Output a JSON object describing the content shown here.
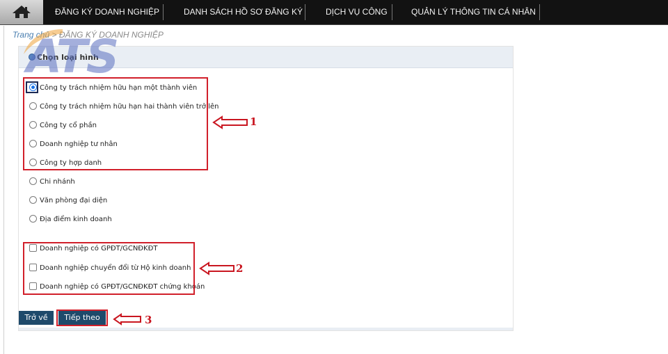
{
  "nav": {
    "items": [
      {
        "label": "ĐĂNG KÝ DOANH NGHIỆP"
      },
      {
        "label": "DANH SÁCH HỒ SƠ ĐĂNG KÝ"
      },
      {
        "label": "DỊCH VỤ CÔNG"
      },
      {
        "label": "QUẢN LÝ THÔNG TIN CÁ NHÂN"
      }
    ]
  },
  "breadcrumb": {
    "home": "Trang chủ",
    "separator": " > ",
    "current": "ĐĂNG KÝ DOANH NGHIỆP"
  },
  "watermark": "ATS",
  "panel": {
    "title": "Chọn loại hình"
  },
  "radio_options": [
    {
      "label": "Công ty trách nhiệm hữu hạn một thành viên",
      "checked": true
    },
    {
      "label": "Công ty trách nhiệm hữu hạn hai thành viên trở lên",
      "checked": false
    },
    {
      "label": "Công ty cổ phần",
      "checked": false
    },
    {
      "label": "Doanh nghiệp tư nhân",
      "checked": false
    },
    {
      "label": "Công ty hợp danh",
      "checked": false
    },
    {
      "label": "Chi nhánh",
      "checked": false
    },
    {
      "label": "Văn phòng đại diện",
      "checked": false
    },
    {
      "label": "Địa điểm kinh doanh",
      "checked": false
    }
  ],
  "checkbox_options": [
    {
      "label": "Doanh nghiệp có GPĐT/GCNĐKĐT",
      "checked": false
    },
    {
      "label": "Doanh nghiệp chuyển đổi từ Hộ kinh doanh",
      "checked": false
    },
    {
      "label": "Doanh nghiệp có GPĐT/GCNĐKĐT chứng khoán",
      "checked": false
    }
  ],
  "buttons": {
    "back": "Trở về",
    "next": "Tiếp theo"
  },
  "annotations": [
    "1",
    "2",
    "3"
  ],
  "colors": {
    "nav_bg": "#121212",
    "button_bg": "#1e4a6b",
    "annotation_red": "#d11f2a",
    "radio_selected": "#1a73e8"
  }
}
